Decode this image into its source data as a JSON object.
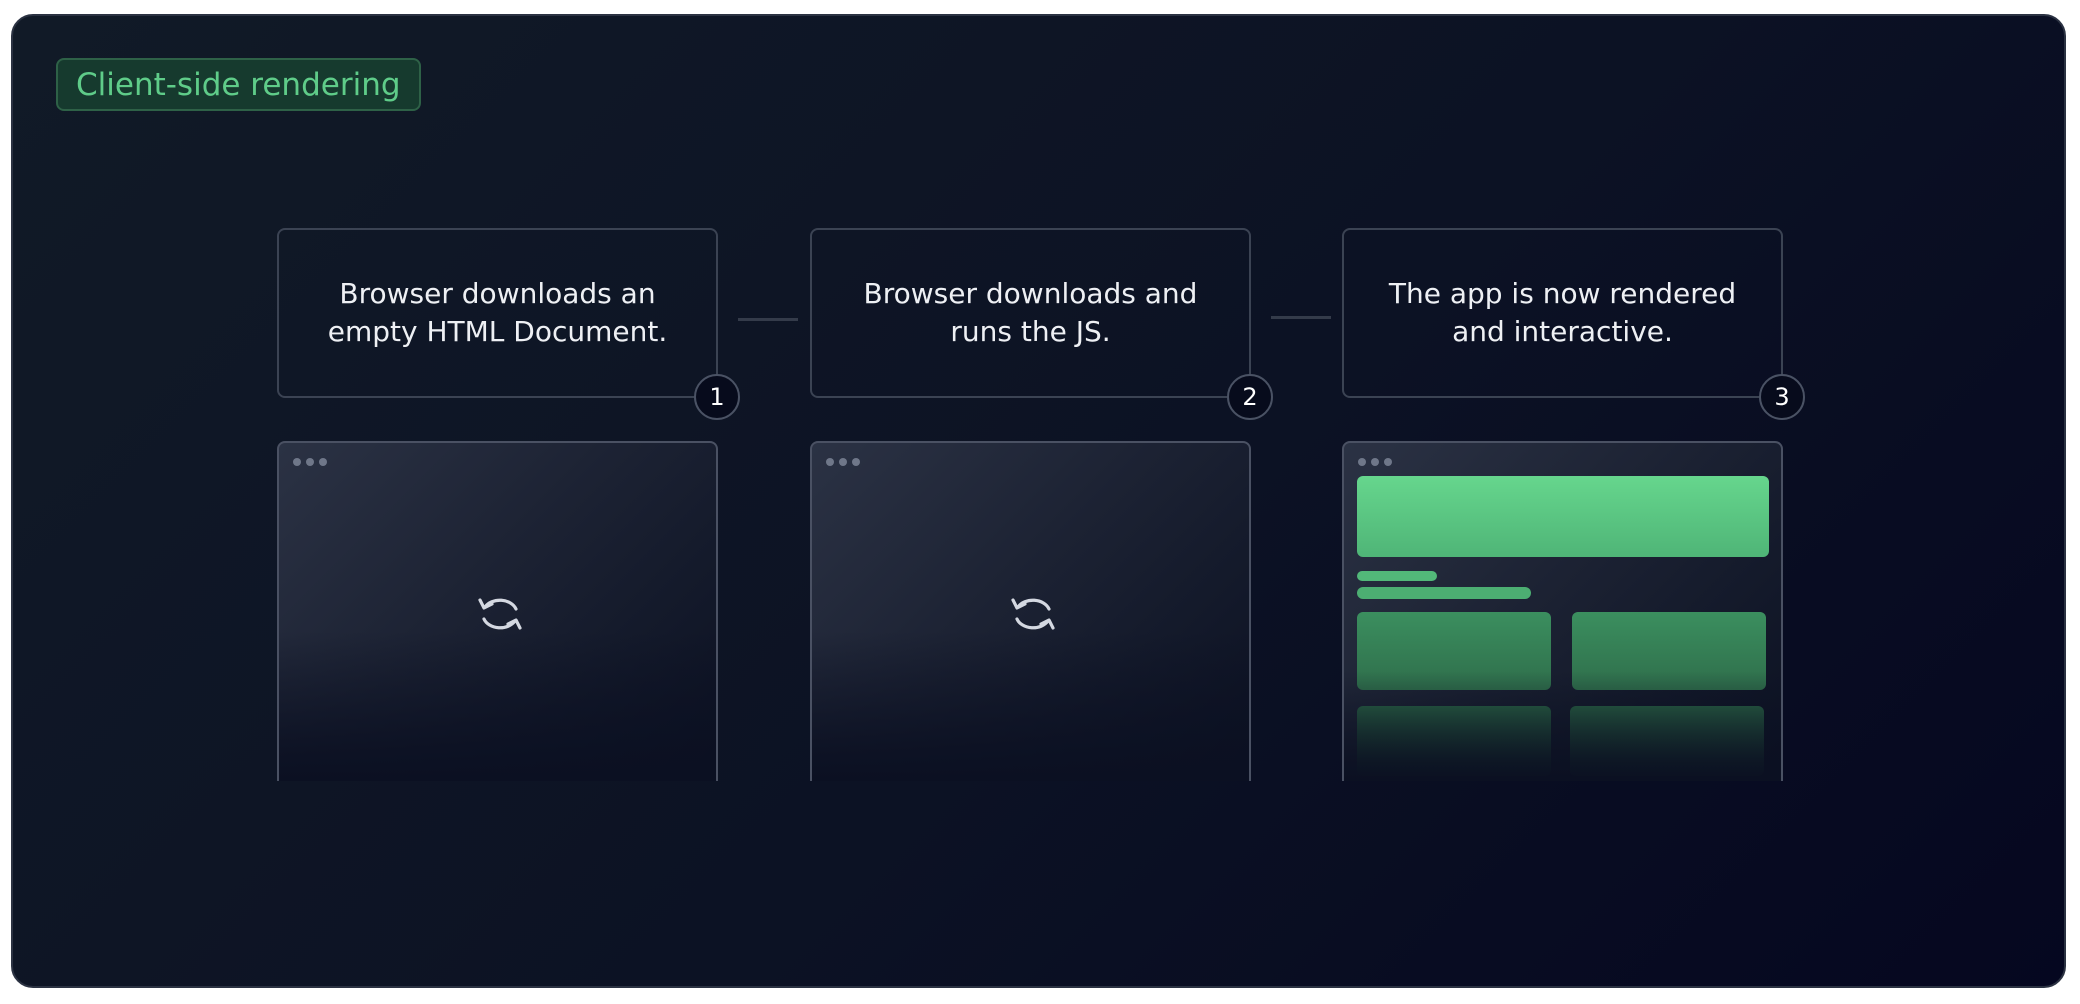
{
  "badge": {
    "label": "Client-side rendering"
  },
  "steps": [
    {
      "number": "1",
      "text": "Browser downloads an empty HTML Document."
    },
    {
      "number": "2",
      "text": "Browser downloads and runs the JS."
    },
    {
      "number": "3",
      "text": "The app is now rendered and interactive."
    }
  ],
  "browsers": [
    {
      "state": "loading",
      "icon": "refresh-icon"
    },
    {
      "state": "loading",
      "icon": "refresh-icon"
    },
    {
      "state": "rendered-app"
    }
  ],
  "colors": {
    "accent_green": "#5fcc89",
    "background": "#0c1224",
    "text": "#eef0f4"
  }
}
